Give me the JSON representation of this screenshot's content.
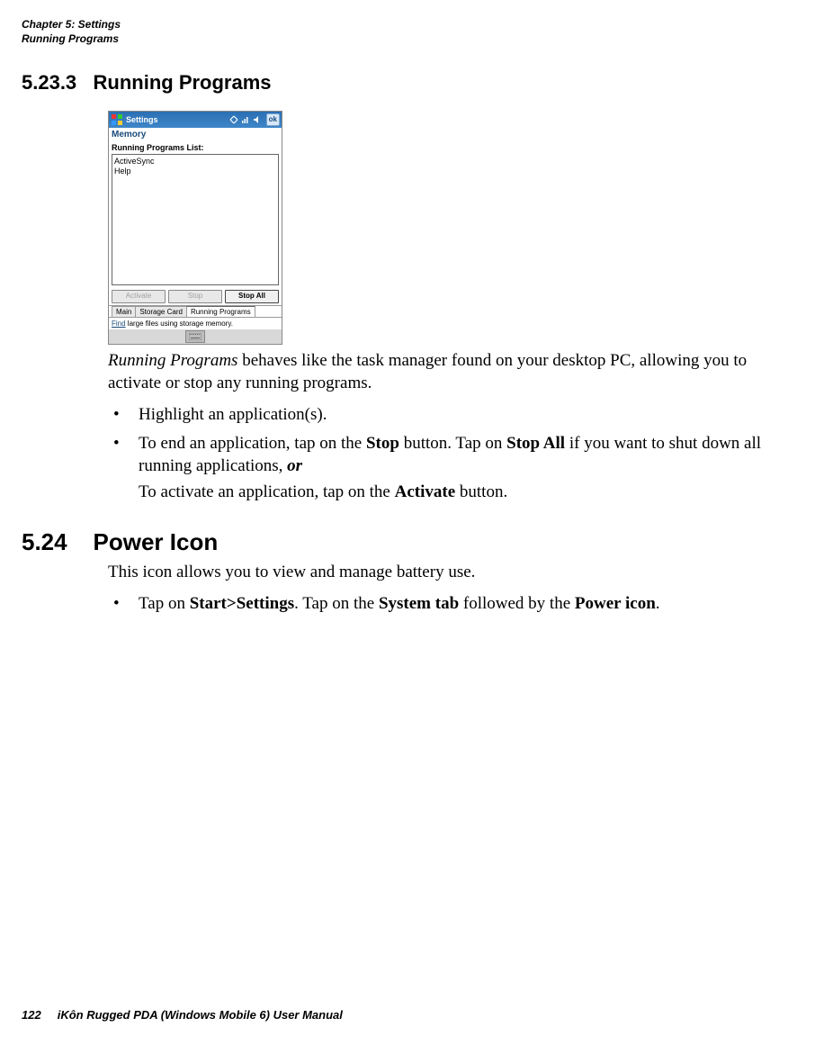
{
  "header": {
    "chapter_line": "Chapter 5: Settings",
    "section_line": "Running Programs"
  },
  "h_5_23_3": {
    "number": "5.23.3",
    "title": "Running Programs"
  },
  "h_5_24": {
    "number": "5.24",
    "title": "Power Icon"
  },
  "pda": {
    "title": "Settings",
    "ok": "ok",
    "tab_header": "Memory",
    "list_label": "Running Programs List:",
    "list_items": [
      "ActiveSync",
      "Help"
    ],
    "btn_activate": "Activate",
    "btn_stop": "Stop",
    "btn_stop_all": "Stop All",
    "tabs": [
      "Main",
      "Storage Card",
      "Running Programs"
    ],
    "find_link": "Find",
    "find_text": " large files using storage memory."
  },
  "body": {
    "rp_intro_em": "Running Programs",
    "rp_intro_rest": " behaves like the task manager found on your desktop PC, allowing you to activate or stop any running programs.",
    "bullet1": "Highlight an application(s).",
    "bullet2_a": "To end an application, tap on the ",
    "bullet2_stop": "Stop",
    "bullet2_b": " button. Tap on ",
    "bullet2_stopall": "Stop All",
    "bullet2_c": " if you want to shut down all running applications, ",
    "bullet2_or": "or",
    "bullet2_sub_a": "To activate an application, tap on the ",
    "bullet2_activate": "Activate",
    "bullet2_sub_b": " button.",
    "power_intro": "This icon allows you to view and manage battery use.",
    "power_b1_a": "Tap on ",
    "power_b1_start": "Start>Settings",
    "power_b1_b": ". Tap on the ",
    "power_b1_system": "System tab",
    "power_b1_c": " followed by the ",
    "power_b1_power": "Power icon",
    "power_b1_d": "."
  },
  "footer": {
    "page_number": "122",
    "manual_title": "iKôn Rugged PDA (Windows Mobile 6) User Manual"
  }
}
